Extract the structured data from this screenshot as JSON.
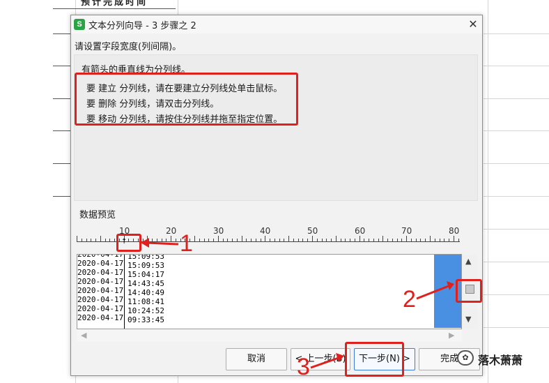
{
  "background": {
    "header_text": "预计完成时间"
  },
  "dialog": {
    "icon": "wps-spreadsheet-icon",
    "icon_glyph": "S",
    "title": "文本分列向导 - 3 步骤之 2",
    "close_label": "✕",
    "prompt": "请设置字段宽度(列间隔)。",
    "info": {
      "line0": "有箭头的垂直线为分列线。",
      "lines": [
        "要 建立 分列线，请在要建立分列线处单击鼠标。",
        "要 删除 分列线，请双击分列线。",
        "要 移动 分列线，请按住分列线并拖至指定位置。"
      ]
    },
    "preview_label": "数据预览",
    "ruler_labels": [
      "10",
      "20",
      "30",
      "40",
      "50",
      "60",
      "70",
      "80"
    ],
    "preview_rows": [
      {
        "c1": "2020-04-17",
        "c2": "15:09:53"
      },
      {
        "c1": "2020-04-17",
        "c2": "15:04:17"
      },
      {
        "c1": "2020-04-17",
        "c2": "14:43:45"
      },
      {
        "c1": "2020-04-17",
        "c2": "14:40:49"
      },
      {
        "c1": "2020-04-17",
        "c2": "11:08:41"
      },
      {
        "c1": "2020-04-17",
        "c2": "10:24:52"
      },
      {
        "c1": "2020-04-17",
        "c2": "09:33:45"
      }
    ],
    "buttons": {
      "cancel": "取消",
      "back": "< 上一步(B)",
      "next": "下一步(N) >",
      "finish": "完成"
    }
  },
  "annotations": {
    "labels": [
      "1",
      "2",
      "3"
    ],
    "color": "#e0201c"
  },
  "watermark": {
    "text": "落木萧萧"
  },
  "colors": {
    "selection": "#4a90e2",
    "app_icon": "#2aa345",
    "accent_border": "#3b7ddb"
  }
}
